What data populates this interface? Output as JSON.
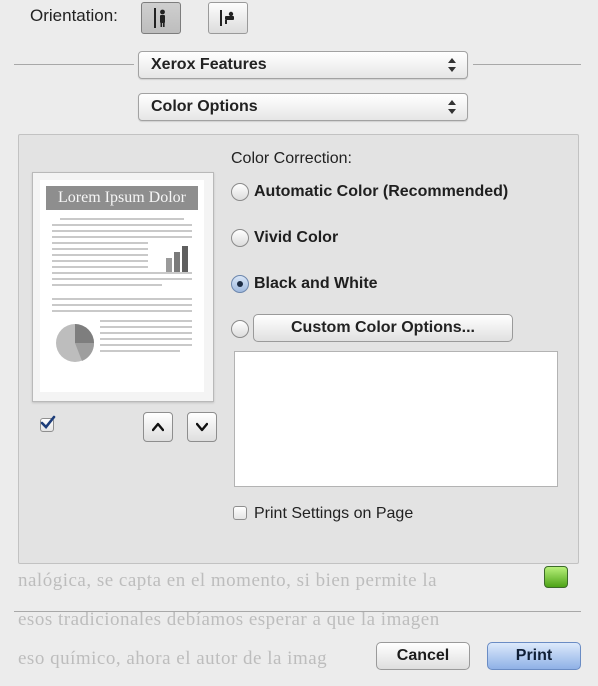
{
  "orientation": {
    "label": "Orientation:",
    "options": [
      {
        "icon": "portrait-orientation-icon",
        "selected": true
      },
      {
        "icon": "landscape-orientation-icon",
        "selected": false
      }
    ]
  },
  "popups": {
    "section": {
      "value": "Xerox Features"
    },
    "subsection": {
      "value": "Color Options"
    }
  },
  "preview": {
    "title": "Lorem Ipsum Dolor",
    "checkbox_checked": true
  },
  "color_correction": {
    "label": "Color Correction:",
    "options": [
      {
        "label": "Automatic Color (Recommended)",
        "selected": false
      },
      {
        "label": "Vivid Color",
        "selected": false
      },
      {
        "label": "Black and White",
        "selected": true
      }
    ],
    "custom_button_label": "Custom Color Options..."
  },
  "print_settings_on_page": {
    "label": "Print Settings on Page",
    "checked": false
  },
  "background_text": [
    "nalógica, se capta en el momento, si bien permite la",
    "esos tradicionales debíamos esperar a que la imagen",
    "eso químico, ahora el autor de la imag"
  ],
  "buttons": {
    "cancel": "Cancel",
    "print": "Print"
  },
  "colors": {
    "accent": "#8fb1e6",
    "panel": "#e3e3e3",
    "vendor_icon": "#4da317"
  }
}
